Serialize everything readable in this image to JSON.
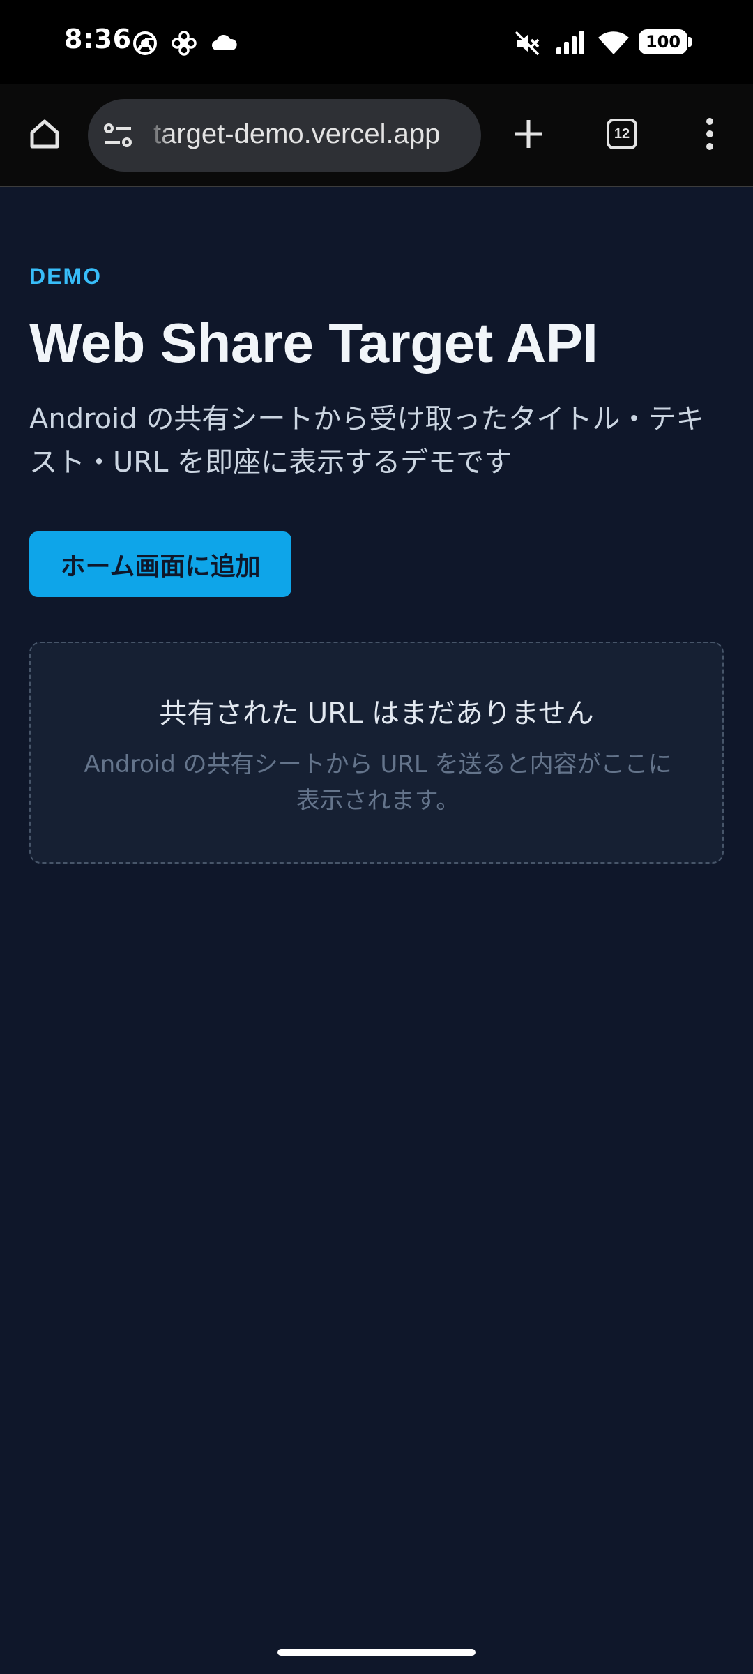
{
  "status_bar": {
    "time": "8:36",
    "battery": "100",
    "left_icons": [
      "chrome-icon",
      "pinwheel-icon",
      "cloud-icon"
    ],
    "right_icons": [
      "mute-icon",
      "signal-icon",
      "wifi-icon",
      "battery-icon"
    ]
  },
  "browser": {
    "url": "target-demo.vercel.app",
    "tab_count": "12",
    "icons": [
      "home-icon",
      "tune-icon",
      "plus-icon",
      "tab-switcher-icon",
      "more-vert-icon"
    ]
  },
  "page": {
    "eyebrow": "DEMO",
    "title": "Web Share Target API",
    "description": "Android の共有シートから受け取ったタイトル・テキスト・URL を即座に表示するデモです",
    "add_to_home_label": "ホーム画面に追加",
    "empty_state": {
      "title": "共有された URL はまだありません",
      "description": "Android の共有シートから URL を送ると内容がここに表示されます。"
    }
  },
  "colors": {
    "background": "#0f172a",
    "accent": "#38bdf8",
    "button": "#0ea5e9",
    "card": "#162033"
  }
}
